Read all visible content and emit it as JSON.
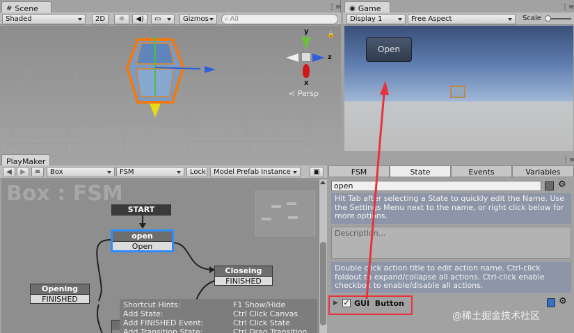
{
  "scene": {
    "tab": "Scene",
    "shading": "Shaded",
    "mode2d": "2D",
    "gizmos": "Gizmos",
    "search_placeholder": "All",
    "gizmo_y": "y",
    "gizmo_x": "x",
    "gizmo_z": "z",
    "persp": "Persp"
  },
  "game": {
    "tab": "Game",
    "display": "Display 1",
    "aspect": "Free Aspect",
    "scale": "Scale",
    "open_button": "Open"
  },
  "playmaker": {
    "tab": "PlayMaker",
    "object": "Box",
    "fsm": "FSM",
    "lock": "Lock",
    "prefab": "Model Prefab Instance",
    "watermark": "Box : FSM",
    "states": {
      "start": "START",
      "open_title": "open",
      "open_event": "Open",
      "closeing_title": "Closeing",
      "closeing_event": "FINISHED",
      "opening_title": "Opening",
      "opening_event": "FINISHED"
    },
    "hints": {
      "title": "Shortcut Hints:",
      "title_key": "F1 Show/Hide",
      "add_state": "Add State:",
      "add_state_key": "Ctrl Click Canvas",
      "add_finished": "Add FINISHED Event:",
      "add_finished_key": "Ctrl Click State",
      "add_transition": "Add Transition State:",
      "add_transition_key": "Ctrl Drag Transition"
    }
  },
  "inspector": {
    "tabs": [
      "FSM",
      "State",
      "Events",
      "Variables"
    ],
    "state_name": "open",
    "hint1": "Hit Tab after selecting a State to quickly edit the Name. Use the Settings Menu next to the name, or right click below for more options.",
    "description_placeholder": "Description...",
    "hint2": "Double click action title to edit action name. Ctrl-click foldout to expand/collapse all actions. Ctrl-click enable checkbox to enable/disable all actions.",
    "action_label": "GUI  Button"
  },
  "watermark": "@稀土掘金技术社区",
  "colors": {
    "highlight_red": "#e8323c",
    "selected_state": "#2f8cff",
    "selection_orange": "#f07a10"
  }
}
